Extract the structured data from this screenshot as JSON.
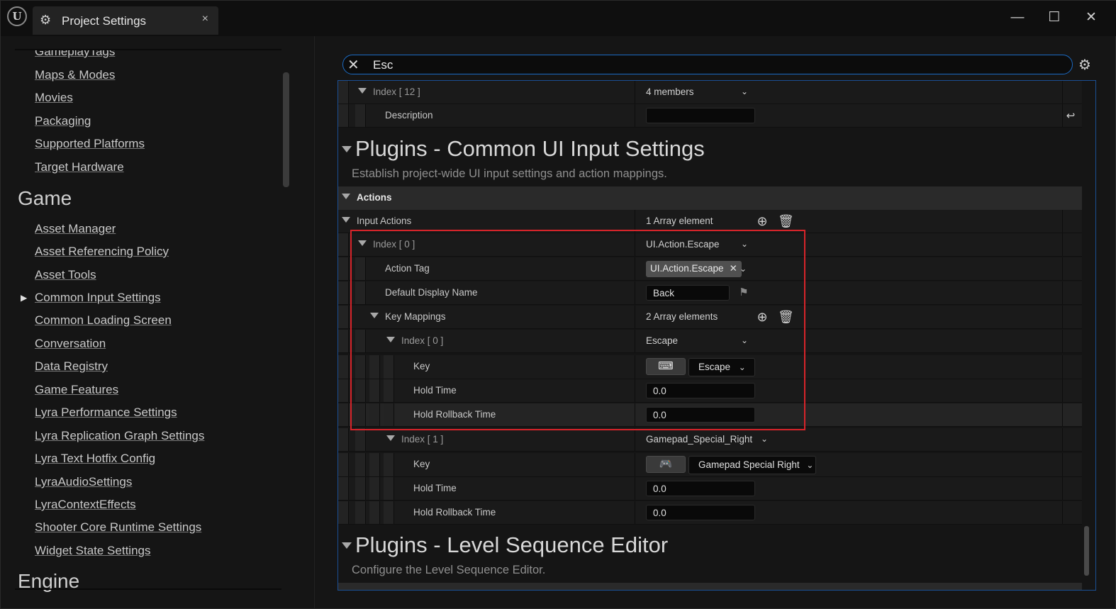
{
  "window": {
    "tab_title": "Project Settings",
    "tab_close": "×",
    "logo": "U",
    "minimize": "—",
    "maximize": "☐",
    "close": "✕"
  },
  "sidebar": {
    "partial_top": "GameplayTags",
    "items_top": [
      "Maps & Modes",
      "Movies",
      "Packaging",
      "Supported Platforms",
      "Target Hardware"
    ],
    "section_game": "Game",
    "items_game": [
      "Asset Manager",
      "Asset Referencing Policy",
      "Asset Tools",
      "Common Input Settings",
      "Common Loading Screen",
      "Conversation",
      "Data Registry",
      "Game Features",
      "Lyra Performance Settings",
      "Lyra Replication Graph Settings",
      "Lyra Text Hotfix Config",
      "LyraAudioSettings",
      "LyraContextEffects",
      "Shooter Core Runtime Settings",
      "Widget State Settings"
    ],
    "section_engine": "Engine"
  },
  "search": {
    "value": "Esc"
  },
  "details": {
    "index12": {
      "label": "Index [ 12 ]",
      "value": "4 members"
    },
    "description": {
      "label": "Description",
      "value": ""
    },
    "common_ui": {
      "title": "Plugins - Common UI Input Settings",
      "desc": "Establish project-wide UI input settings and action mappings."
    },
    "actions_category": "Actions",
    "input_actions": {
      "label": "Input Actions",
      "value": "1 Array element"
    },
    "index0": {
      "label": "Index [ 0 ]",
      "value": "UI.Action.Escape"
    },
    "action_tag": {
      "label": "Action Tag",
      "value": "UI.Action.Escape"
    },
    "default_display_name": {
      "label": "Default Display Name",
      "value": "Back"
    },
    "key_mappings": {
      "label": "Key Mappings",
      "value": "2 Array elements"
    },
    "km0": {
      "label": "Index [ 0 ]",
      "value": "Escape",
      "key_label": "Key",
      "key_value": "Escape",
      "hold_label": "Hold Time",
      "hold_value": "0.0",
      "rollback_label": "Hold Rollback Time",
      "rollback_value": "0.0"
    },
    "km1": {
      "label": "Index [ 1 ]",
      "value": "Gamepad_Special_Right",
      "key_label": "Key",
      "key_value": "Gamepad Special Right",
      "hold_label": "Hold Time",
      "hold_value": "0.0",
      "rollback_label": "Hold Rollback Time",
      "rollback_value": "0.0"
    },
    "level_sequence": {
      "title": "Plugins - Level Sequence Editor",
      "desc": "Configure the Level Sequence Editor."
    }
  },
  "colors": {
    "accent_blue": "#1b6bc4",
    "highlight_red": "#d8242a"
  }
}
